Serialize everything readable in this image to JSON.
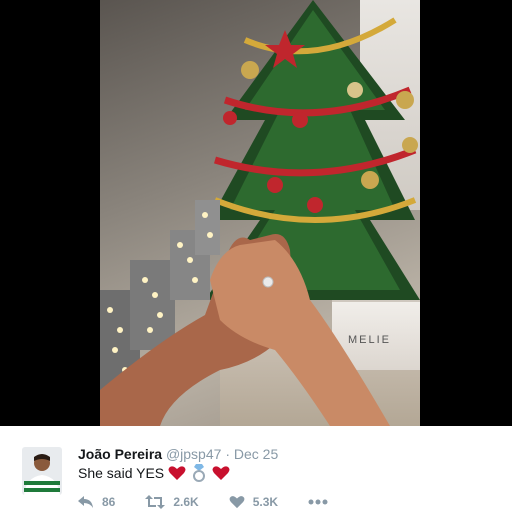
{
  "tweet": {
    "author_name": "João Pereira",
    "handle": "@jpsp47",
    "separator": "·",
    "date": "Dec 25",
    "text": "She said YES",
    "emojis": [
      "heart-icon",
      "ring-icon",
      "heart-icon"
    ],
    "emoji_colors": {
      "heart": "#c8102e",
      "ring": "#4a90d9"
    }
  },
  "media": {
    "bag_text": "MELIE"
  },
  "actions": {
    "reply_count": "86",
    "retweet_count": "2.6K",
    "like_count": "5.3K"
  },
  "colors": {
    "muted": "#8899a6",
    "text": "#14171a"
  }
}
